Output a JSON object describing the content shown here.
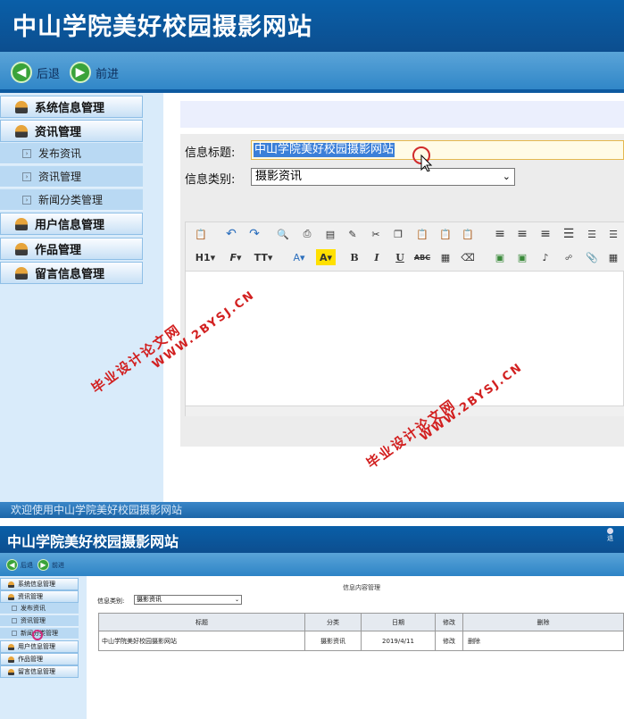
{
  "app": {
    "title": "中山学院美好校园摄影网站",
    "footer": "欢迎使用中山学院美好校园摄影网站"
  },
  "nav": {
    "back": "后退",
    "forward": "前进"
  },
  "sidebar": {
    "items": [
      {
        "label": "系统信息管理",
        "type": "main"
      },
      {
        "label": "资讯管理",
        "type": "main"
      },
      {
        "label": "发布资讯",
        "type": "sub"
      },
      {
        "label": "资讯管理",
        "type": "sub"
      },
      {
        "label": "新闻分类管理",
        "type": "sub"
      },
      {
        "label": "用户信息管理",
        "type": "main"
      },
      {
        "label": "作品管理",
        "type": "main"
      },
      {
        "label": "留言信息管理",
        "type": "main"
      }
    ]
  },
  "form": {
    "title_label": "信息标题:",
    "title_value": "中山学院美好校园摄影网站",
    "category_label": "信息类别:",
    "category_value": "摄影资讯"
  },
  "editor": {
    "toolbar_row2": {
      "heading": "H1",
      "font": "F",
      "size": "TT",
      "font_color": "A",
      "highlight": "A",
      "bold": "B",
      "italic": "I",
      "underline": "U",
      "strike": "ABC"
    },
    "icons": [
      "paste-icon",
      "undo-icon",
      "redo-icon",
      "preview-icon",
      "print-icon",
      "template-icon",
      "code-icon",
      "cut-icon",
      "copy-icon",
      "paste-text-icon",
      "paste-word-icon",
      "paste-plain-icon",
      "align-left-icon",
      "align-center-icon",
      "align-right-icon",
      "align-justify-icon",
      "ordered-list-icon",
      "unordered-list-icon",
      "removeformat-icon",
      "hr-icon",
      "image-icon",
      "flash-icon",
      "media-icon",
      "attachment-icon",
      "table-icon"
    ]
  },
  "watermark": {
    "line1": "毕业设计论文网",
    "line2": "WWW.2BYSJ.CN"
  },
  "bottom": {
    "title": "中山学院美好校园摄影网站",
    "user_text": "退",
    "nav_back": "后退",
    "nav_forward": "前进",
    "main_title": "信息内容管理",
    "category_label": "信息类别:",
    "category_value": "摄影资讯",
    "table": {
      "headers": [
        "标题",
        "分类",
        "日期",
        "修改",
        "删除"
      ],
      "rows": [
        [
          "中山学院美好校园摄影网站",
          "摄影资讯",
          "2019/4/11",
          "修改",
          "删除"
        ]
      ]
    }
  },
  "colors": {
    "header": "#0c5aa0",
    "nav": "#3f92d0",
    "sidebar": "#d9ebfa",
    "selection": "#3b7fd8",
    "watermark": "#d22020"
  }
}
